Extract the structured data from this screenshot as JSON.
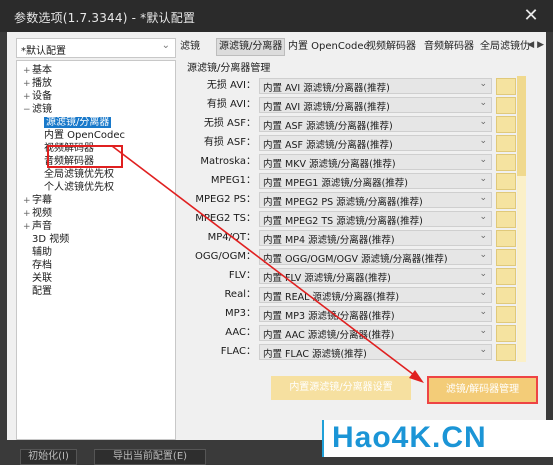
{
  "window": {
    "title": "参数选项(1.7.3344) - *默认配置"
  },
  "profile": {
    "selected": "*默认配置"
  },
  "tree": [
    {
      "label": "基本",
      "expander": "+"
    },
    {
      "label": "播放",
      "expander": "+"
    },
    {
      "label": "设备",
      "expander": "+"
    },
    {
      "label": "滤镜",
      "expander": "−"
    },
    {
      "label": "源滤镜/分离器",
      "expander": ""
    },
    {
      "label": "内置 OpenCodec",
      "expander": ""
    },
    {
      "label": "视频解码器",
      "expander": ""
    },
    {
      "label": "音频解码器",
      "expander": ""
    },
    {
      "label": "全局滤镜优先权",
      "expander": ""
    },
    {
      "label": "个人滤镜优先权",
      "expander": ""
    },
    {
      "label": "字幕",
      "expander": "+"
    },
    {
      "label": "视频",
      "expander": "+"
    },
    {
      "label": "声音",
      "expander": "+"
    },
    {
      "label": "3D 视频",
      "expander": ""
    },
    {
      "label": "辅助",
      "expander": ""
    },
    {
      "label": "存档",
      "expander": ""
    },
    {
      "label": "关联",
      "expander": ""
    },
    {
      "label": "配置",
      "expander": ""
    }
  ],
  "tabs": [
    "滤镜",
    "源滤镜/分离器",
    "内置 OpenCodec",
    "视频解码器",
    "音频解码器",
    "全局滤镜仂"
  ],
  "tab_scroll": "◀ ▶",
  "section_title": "源滤镜/分离器管理",
  "filters": [
    {
      "label": "无损 AVI：",
      "value": "内置 AVI 源滤镜/分离器(推荐)"
    },
    {
      "label": "有损 AVI：",
      "value": "内置 AVI 源滤镜/分离器(推荐)"
    },
    {
      "label": "无损 ASF：",
      "value": "内置 ASF 源滤镜/分离器(推荐)"
    },
    {
      "label": "有损 ASF：",
      "value": "内置 ASF 源滤镜/分离器(推荐)"
    },
    {
      "label": "Matroska：",
      "value": "内置 MKV 源滤镜/分离器(推荐)"
    },
    {
      "label": "MPEG1：",
      "value": "内置 MPEG1 源滤镜/分离器(推荐)"
    },
    {
      "label": "MPEG2 PS：",
      "value": "内置 MPEG2 PS 源滤镜/分离器(推荐)"
    },
    {
      "label": "MPEG2 TS：",
      "value": "内置 MPEG2 TS 源滤镜/分离器(推荐)"
    },
    {
      "label": "MP4/QT：",
      "value": "内置 MP4 源滤镜/分离器(推荐)"
    },
    {
      "label": "OGG/OGM：",
      "value": "内置 OGG/OGM/OGV 源滤镜/分离器(推荐)"
    },
    {
      "label": "FLV：",
      "value": "内置 FLV 源滤镜/分离器(推荐)"
    },
    {
      "label": "Real：",
      "value": "内置 REAL 源滤镜/分离器(推荐)"
    },
    {
      "label": "MP3：",
      "value": "内置 MP3 源滤镜/分离器(推荐)"
    },
    {
      "label": "AAC：",
      "value": "内置 AAC 源滤镜/分离器(推荐)"
    },
    {
      "label": "FLAC：",
      "value": "内置 FLAC 源滤镜(推荐)"
    }
  ],
  "buttons": {
    "internal": "内置源滤镜/分离器设置",
    "manager": "滤镜/解码器管理"
  },
  "footer": {
    "init": "初始化(I)",
    "export": "导出当前配置(E)"
  },
  "watermark": "Hao4K.CN",
  "colors": {
    "highlight": "#e02020",
    "button_yellow": "#f3cc78",
    "tree_selected": "#1979ca"
  }
}
